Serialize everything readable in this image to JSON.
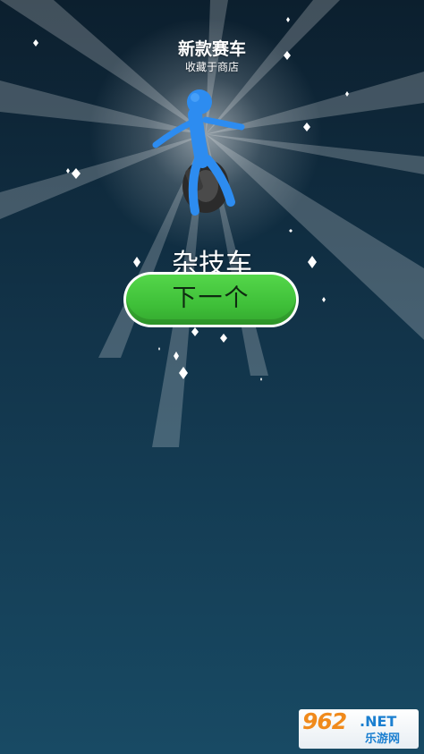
{
  "reward": {
    "title": "新款赛车",
    "subtitle": "收藏于商店"
  },
  "item": {
    "name": "杂技车"
  },
  "next_button": {
    "label": "下一个"
  },
  "watermark": {
    "logo": "962",
    "domain": ".NET",
    "site_name": "乐游网"
  },
  "colors": {
    "background_top": "#0c1f2e",
    "background_bottom": "#184a64",
    "button_green": "#3fc039",
    "character_blue": "#2d8cf0",
    "watermark_orange": "#f08a1c",
    "watermark_blue": "#1b7fd0"
  }
}
